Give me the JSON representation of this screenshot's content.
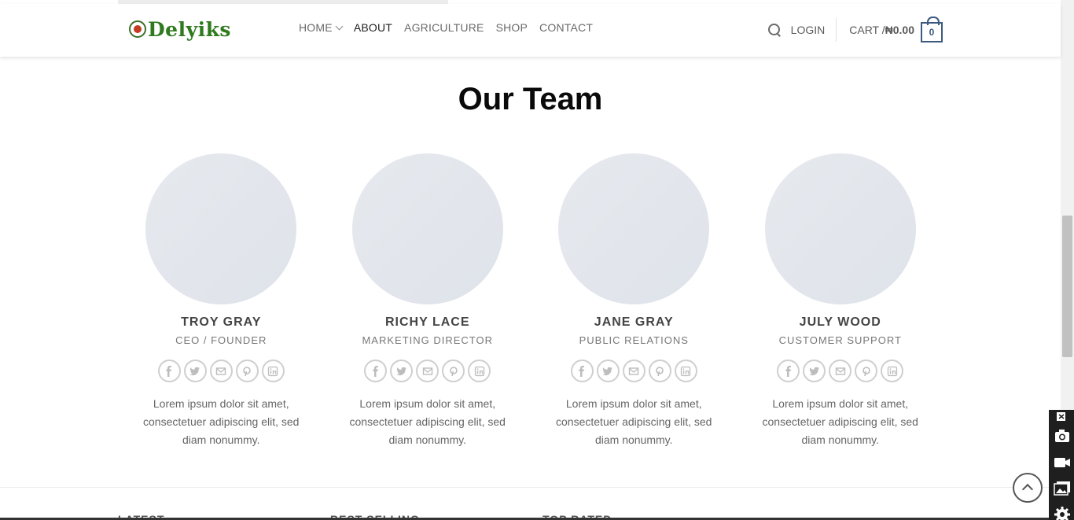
{
  "brand": {
    "logo_text": "Delyiks"
  },
  "nav": {
    "items": [
      {
        "label": "HOME",
        "has_dropdown": true
      },
      {
        "label": "ABOUT",
        "active": true
      },
      {
        "label": "AGRICULTURE"
      },
      {
        "label": "SHOP"
      },
      {
        "label": "CONTACT"
      }
    ]
  },
  "header_right": {
    "login": "LOGIN",
    "cart_label": "CART / ",
    "cart_amount": "₦0.00",
    "cart_count": "0"
  },
  "section": {
    "title": "Our Team"
  },
  "team": [
    {
      "name": "TROY GRAY",
      "role": "CEO / FOUNDER",
      "bio": "Lorem ipsum dolor sit amet, consectetuer adipiscing elit, sed diam nonummy."
    },
    {
      "name": "RICHY LACE",
      "role": "MARKETING DIRECTOR",
      "bio": "Lorem ipsum dolor sit amet, consectetuer adipiscing elit, sed diam nonummy."
    },
    {
      "name": "JANE GRAY",
      "role": "PUBLIC RELATIONS",
      "bio": "Lorem ipsum dolor sit amet, consectetuer adipiscing elit, sed diam nonummy."
    },
    {
      "name": "JULY WOOD",
      "role": "CUSTOMER SUPPORT",
      "bio": "Lorem ipsum dolor sit amet, consectetuer adipiscing elit, sed diam nonummy."
    }
  ],
  "social_icons": [
    "facebook-icon",
    "twitter-icon",
    "email-icon",
    "pinterest-icon",
    "linkedin-icon"
  ],
  "footer": {
    "headings": [
      "LATEST",
      "BEST SELLING",
      "TOP RATED"
    ]
  },
  "colors": {
    "brand_green": "#2f7a1f",
    "cart_accent": "#3c5a80",
    "photo_placeholder": "#e3e7ed"
  }
}
